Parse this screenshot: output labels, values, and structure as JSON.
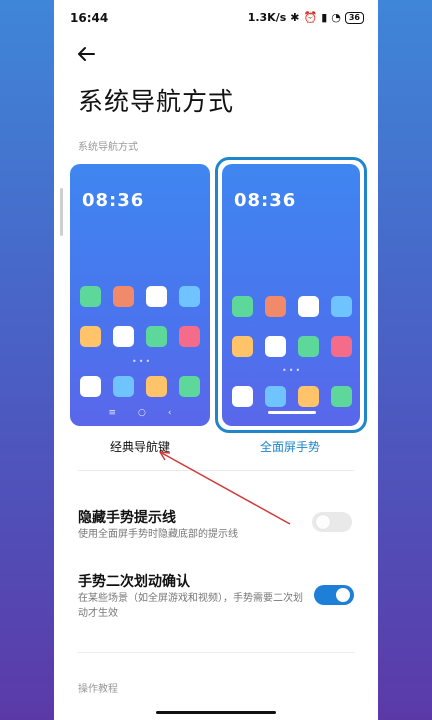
{
  "status": {
    "time": "16:44",
    "net_speed": "1.3K/s",
    "battery": "36"
  },
  "page": {
    "title": "系统导航方式",
    "section_label": "系统导航方式"
  },
  "nav_modes": {
    "classic": {
      "label": "经典导航键",
      "time": "08:36",
      "selected": false
    },
    "gesture": {
      "label": "全面屏手势",
      "time": "08:36",
      "selected": true
    }
  },
  "settings": {
    "hide_hint": {
      "title": "隐藏手势提示线",
      "desc": "使用全面屏手势时隐藏底部的提示线",
      "enabled": false
    },
    "double_swipe": {
      "title": "手势二次划动确认",
      "desc": "在某些场景（如全屏游戏和视频），手势需要二次划动才生效",
      "enabled": true
    }
  },
  "tutorial": {
    "label": "操作教程"
  },
  "colors": {
    "accent": "#1e86c9",
    "toggle_on": "#1e7fd9",
    "annotation_arrow": "#d23a3a"
  }
}
